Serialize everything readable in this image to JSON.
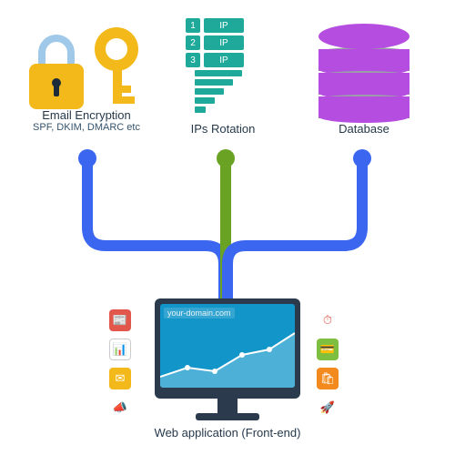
{
  "top": {
    "encryption": {
      "title": "Email Encryption",
      "subtitle": "SPF, DKIM, DMARC etc"
    },
    "ips": {
      "title": "IPs Rotation",
      "rows": [
        {
          "n": "1",
          "t": "IP"
        },
        {
          "n": "2",
          "t": "IP"
        },
        {
          "n": "3",
          "t": "IP"
        }
      ]
    },
    "database": {
      "title": "Database"
    }
  },
  "bottom": {
    "title": "Web application (Front-end)",
    "url": "your-domain.com"
  },
  "colors": {
    "teal": "#1fa99a",
    "blue": "#3a66f0",
    "green": "#6aa223",
    "purple": "#b54ee0",
    "gold": "#f3b81a",
    "dark": "#2b3b4d"
  },
  "icons": {
    "left": [
      "news",
      "stats",
      "mail",
      "megaphone"
    ],
    "right": [
      "clock",
      "card",
      "bag",
      "rocket"
    ]
  }
}
